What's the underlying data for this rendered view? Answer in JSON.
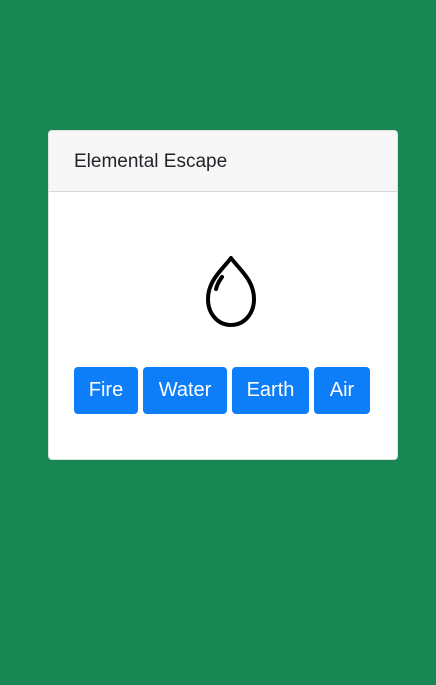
{
  "card": {
    "title": "Elemental Escape"
  },
  "element_display": {
    "icon": "water-drop-icon"
  },
  "buttons": {
    "fire": "Fire",
    "water": "Water",
    "earth": "Earth",
    "air": "Air"
  },
  "colors": {
    "background": "#198754",
    "button": "#0d7ef7",
    "card_header": "#f7f7f7"
  }
}
